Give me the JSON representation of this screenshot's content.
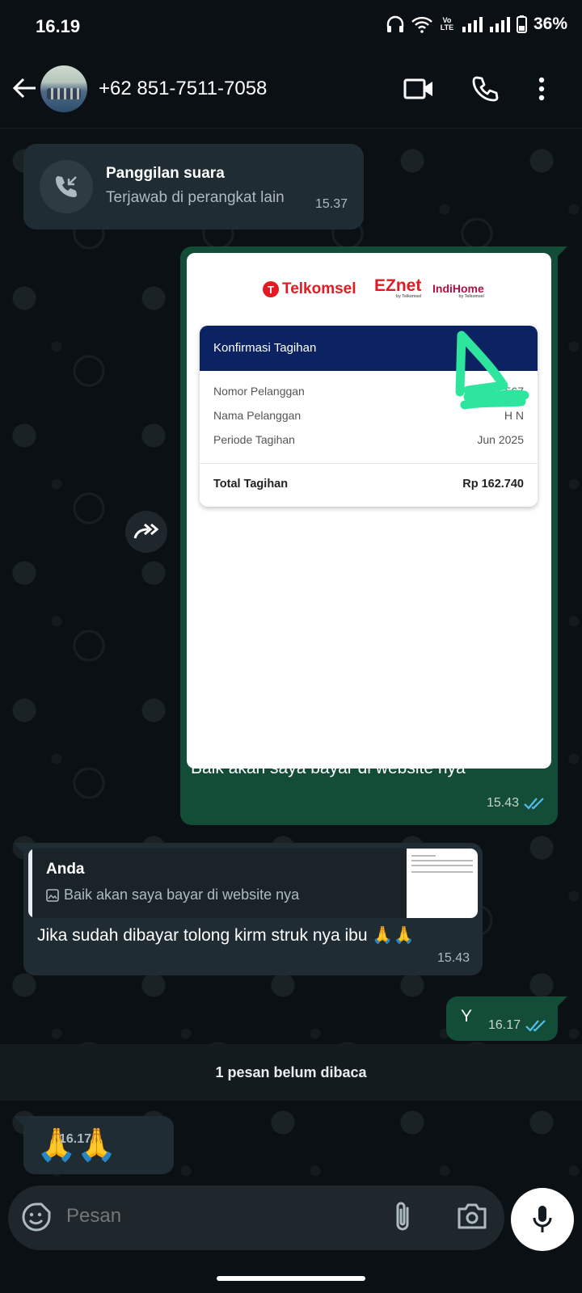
{
  "status": {
    "time": "16.19",
    "battery": "36%",
    "network_label": "Vo LTE"
  },
  "header": {
    "contact": "+62 851-7511-7058"
  },
  "messages": {
    "call": {
      "title": "Panggilan suara",
      "subtitle": "Terjawab di perangkat lain",
      "time": "15.37"
    },
    "image": {
      "receipt": {
        "logos": [
          "Telkomsel",
          "EZnet",
          "IndiHome"
        ],
        "logo_sub": "by Telkomsel",
        "header": "Konfirmasi Tagihan",
        "rows": [
          {
            "label": "Nomor Pelanggan",
            "value": "01227     567"
          },
          {
            "label": "Nama Pelanggan",
            "value": "H      N"
          },
          {
            "label": "Periode Tagihan",
            "value": "Jun 2025"
          }
        ],
        "total_label": "Total Tagihan",
        "total_value": "Rp 162.740"
      },
      "caption": "Baik akan saya bayar di website nya",
      "time": "15.43",
      "tick_color": "#53bdeb"
    },
    "reply": {
      "quoted_name": "Anda",
      "quoted_text": "Baik akan saya bayar di website nya",
      "text": "Jika sudah dibayar tolong kirm struk nya ibu 🙏🙏",
      "time": "15.43"
    },
    "short": {
      "text": "Y",
      "time": "16.17"
    },
    "unread_banner": "1 pesan belum dibaca",
    "last": {
      "text": "🙏🙏",
      "time": "16.17"
    }
  },
  "composer": {
    "placeholder": "Pesan"
  },
  "colors": {
    "outgoing_bubble": "#144d37",
    "incoming_bubble": "#202c33",
    "background": "#0b1014",
    "read_ticks": "#53bdeb"
  }
}
